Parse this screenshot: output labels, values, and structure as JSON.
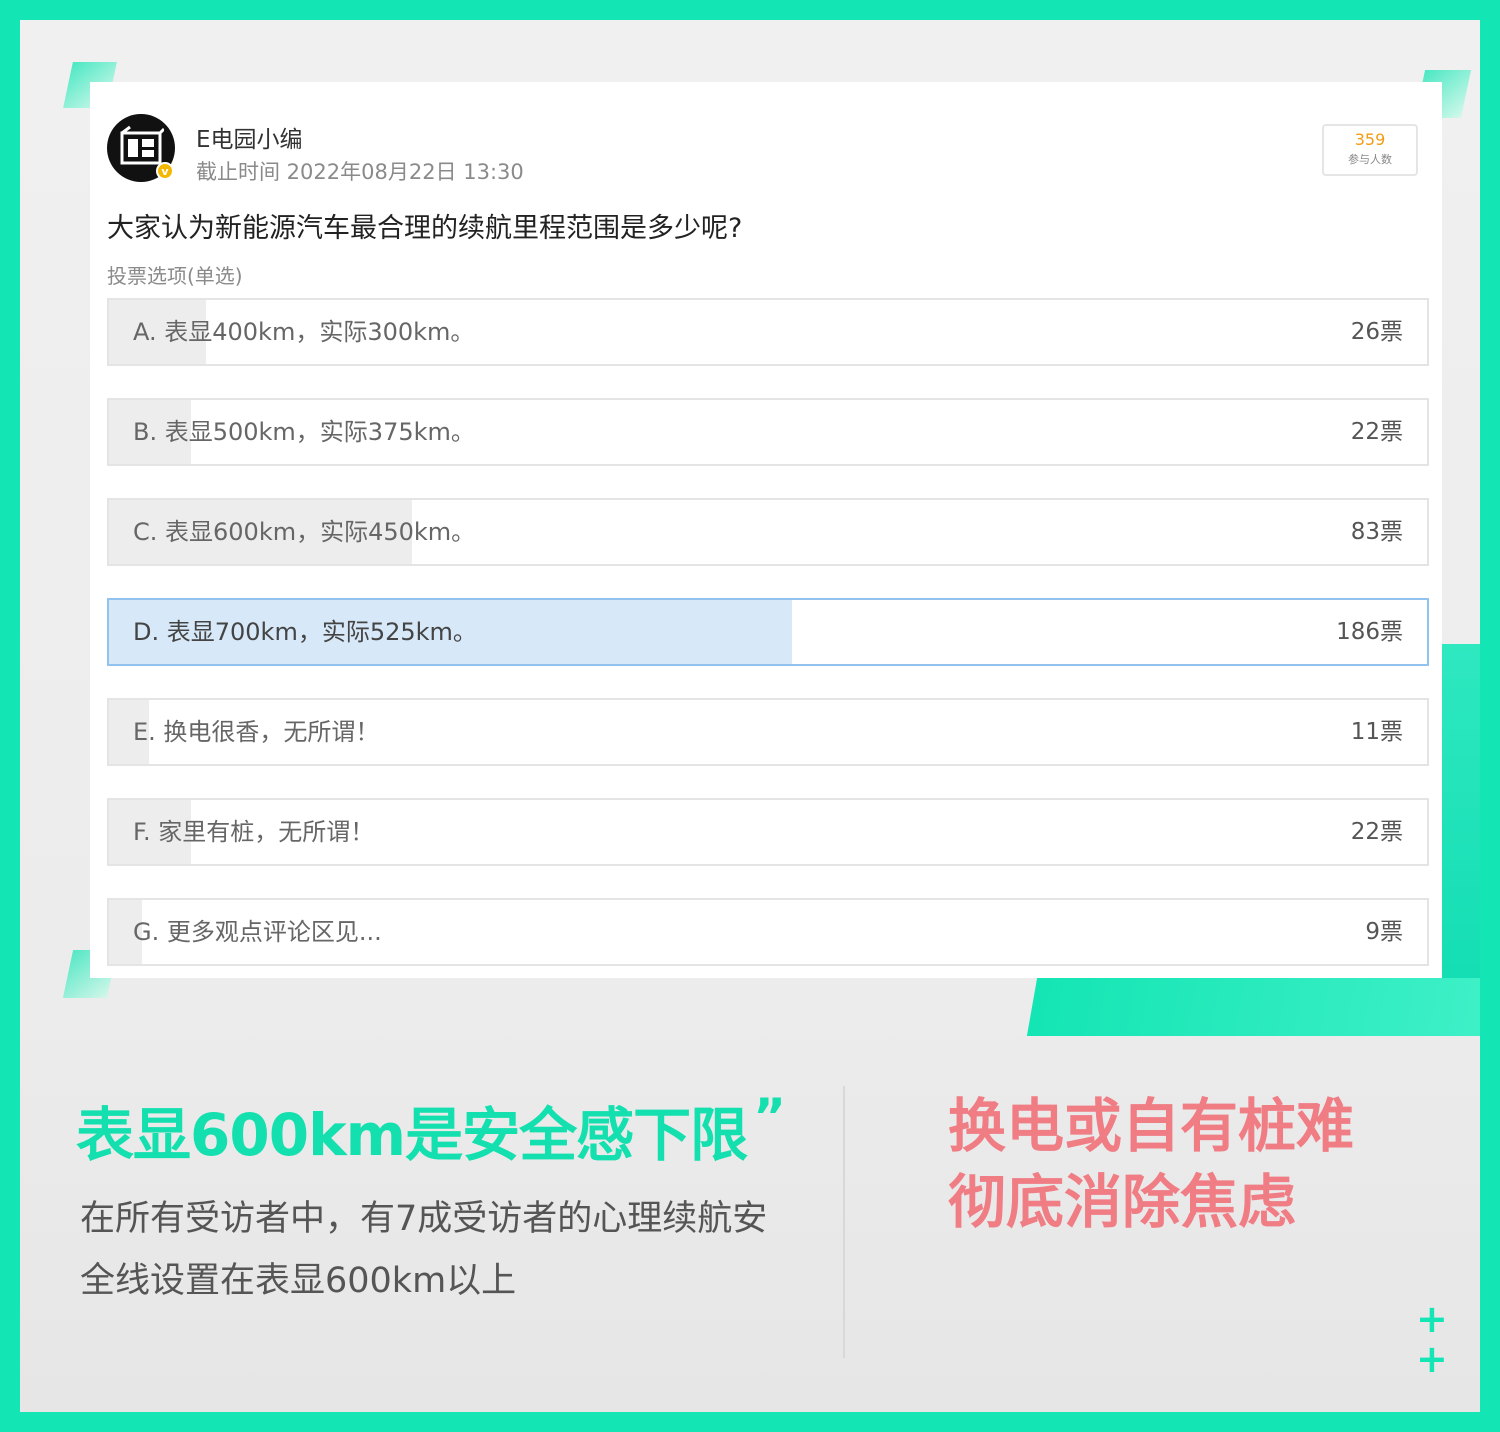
{
  "post": {
    "author": "E电园小编",
    "deadline": "截止时间 2022年08月22日 13:30",
    "participants_count": "359",
    "participants_label": "参与人数",
    "question": "大家认为新能源汽车最合理的续航里程范围是多少呢?",
    "vote_type": "投票选项(单选)",
    "options": [
      {
        "label": "A. 表显400km，实际300km。",
        "votes": "26票",
        "share": 0.0739,
        "selected": false
      },
      {
        "label": "B. 表显500km，实际375km。",
        "votes": "22票",
        "share": 0.0625,
        "selected": false
      },
      {
        "label": "C. 表显600km，实际450km。",
        "votes": "83票",
        "share": 0.2301,
        "selected": false
      },
      {
        "label": "D. 表显700km，实际525km。",
        "votes": "186票",
        "share": 0.5181,
        "selected": true
      },
      {
        "label": "E. 换电很香，无所谓！",
        "votes": "11票",
        "share": 0.0306,
        "selected": false
      },
      {
        "label": "F. 家里有桩，无所谓！",
        "votes": "22票",
        "share": 0.0625,
        "selected": false
      },
      {
        "label": "G. 更多观点评论区见...",
        "votes": "9票",
        "share": 0.0251,
        "selected": false
      }
    ]
  },
  "caption": {
    "headline_left": "表显600km是安全感下限",
    "headline_left_quote": "”",
    "body": "在所有受访者中，有7成受访者的心理续航安全线设置在表显600km以上",
    "headline_right": "换电或自有桩难彻底消除焦虑",
    "plus_1": "+",
    "plus_2": "+"
  },
  "colors": {
    "accent": "#14e5b4",
    "pink": "#f07c84",
    "selected_fill": "#d7e8f8",
    "fill": "#ededed"
  }
}
